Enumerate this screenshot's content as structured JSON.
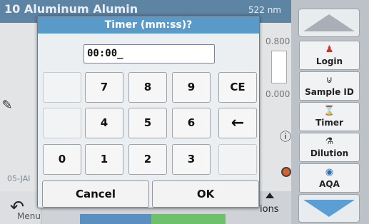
{
  "background": {
    "program_title": "10 Aluminum Alumin",
    "wavelength": "522 nm",
    "value_top": "0.800",
    "value_bottom": "0.000",
    "date": "05-JAI",
    "back_label": "Menu",
    "options_label": "ions"
  },
  "sidebar": {
    "items": [
      {
        "label": "Login",
        "icon": "person-icon"
      },
      {
        "label": "Sample ID",
        "icon": "beaker-icon"
      },
      {
        "label": "Timer",
        "icon": "timer-icon"
      },
      {
        "label": "Dilution",
        "icon": "dilution-icon"
      },
      {
        "label": "AQA",
        "icon": "aqa-icon"
      }
    ]
  },
  "dialog": {
    "title": "Timer (mm:ss)?",
    "input_value": "00:00_",
    "keys": {
      "r1": [
        "",
        "7",
        "8",
        "9",
        "CE"
      ],
      "r2": [
        "",
        "4",
        "5",
        "6",
        "←"
      ],
      "r3": [
        "0",
        "1",
        "2",
        "3",
        ""
      ]
    },
    "cancel_label": "Cancel",
    "ok_label": "OK"
  },
  "colors": {
    "title_bar": "#5a9ac8",
    "header_bar": "#5e84a4",
    "scroll_down": "#5b9ed3"
  }
}
